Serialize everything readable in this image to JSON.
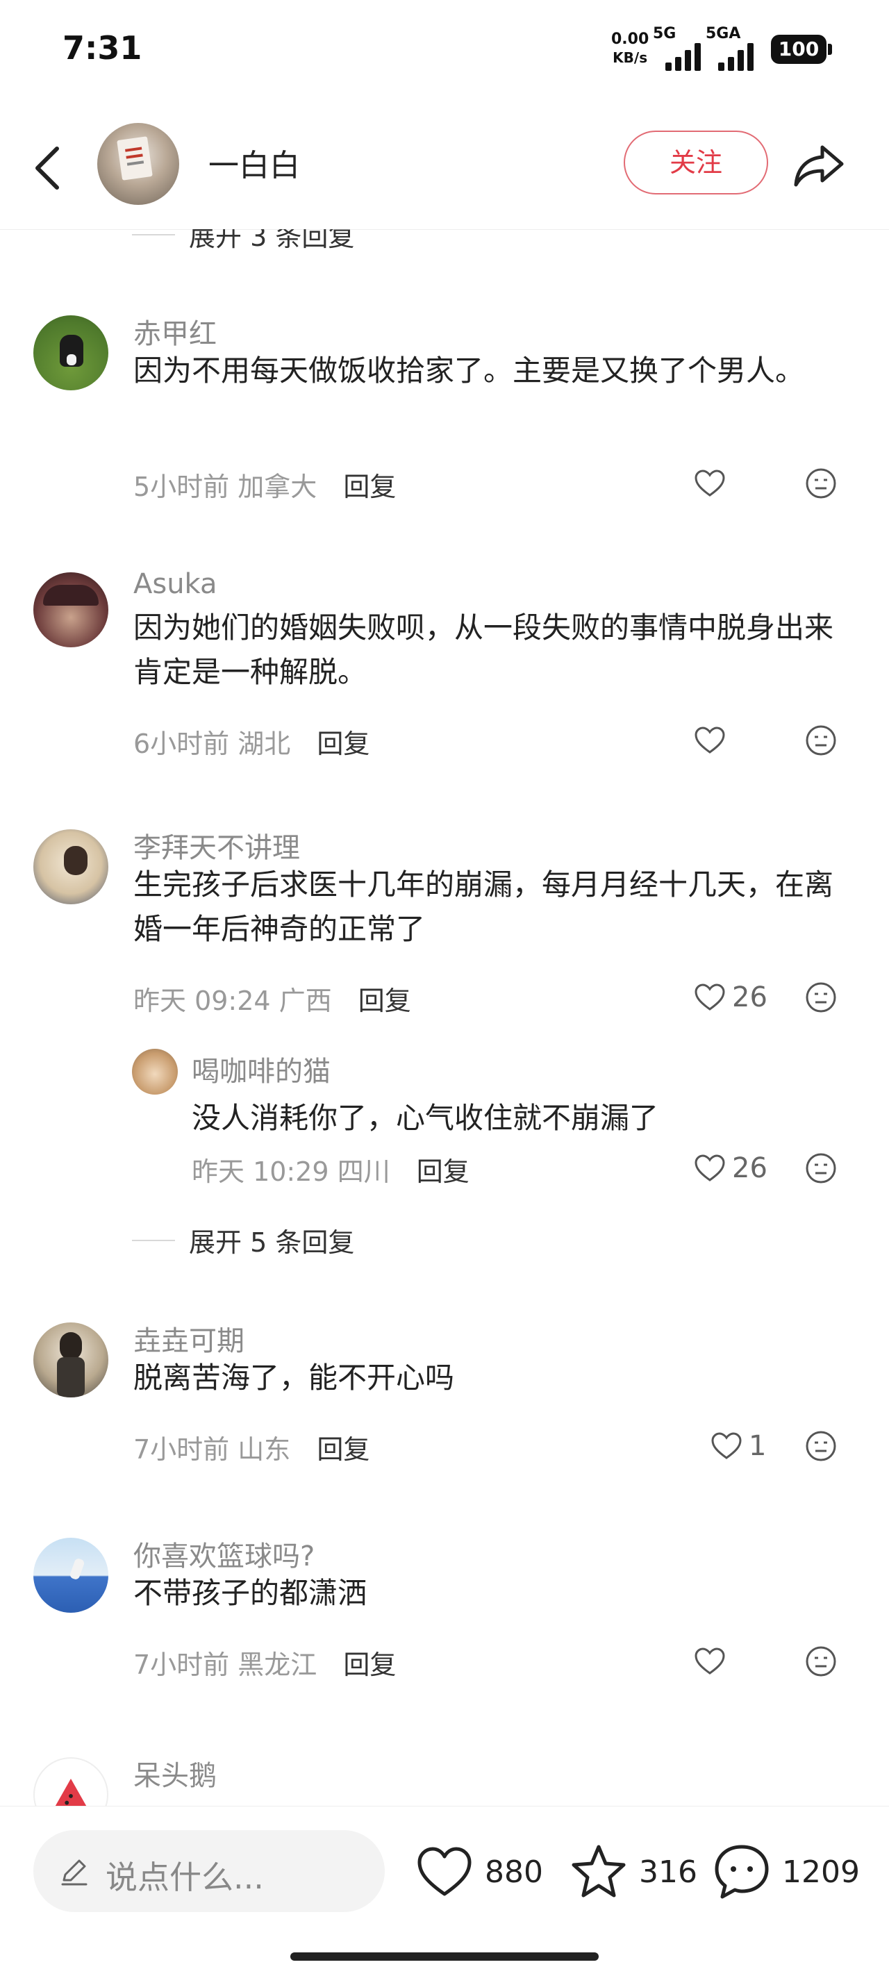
{
  "status_bar": {
    "time": "7:31",
    "net_speed_value": "0.00",
    "net_speed_unit": "KB/s",
    "signal1_label": "5G",
    "signal2_label": "5GA",
    "battery": "100"
  },
  "header": {
    "username": "一白白",
    "follow_label": "关注"
  },
  "colors": {
    "accent": "#e23b47",
    "text_primary": "#222222",
    "text_secondary": "#999999"
  },
  "top_expand": {
    "label": "展开 3 条回复"
  },
  "comments": [
    {
      "user": "赤甲红",
      "text": "因为不用每天做饭收拾家了。主要是又换了个男人。",
      "time": "5小时前",
      "location": "加拿大",
      "reply_label": "回复",
      "likes": ""
    },
    {
      "user": "Asuka",
      "text": "因为她们的婚姻失败呗，从一段失败的事情中脱身出来肯定是一种解脱。",
      "time": "6小时前",
      "location": "湖北",
      "reply_label": "回复",
      "likes": ""
    },
    {
      "user": "李拜天不讲理",
      "text": "生完孩子后求医十几年的崩漏，每月月经十几天，在离婚一年后神奇的正常了",
      "time": "昨天 09:24",
      "location": "广西",
      "reply_label": "回复",
      "likes": "26",
      "reply": {
        "user": "喝咖啡的猫",
        "text": "没人消耗你了，心气收住就不崩漏了",
        "time": "昨天 10:29",
        "location": "四川",
        "reply_label": "回复",
        "likes": "26"
      },
      "expand_label": "展开 5 条回复"
    },
    {
      "user": "垚垚可期",
      "text": "脱离苦海了，能不开心吗",
      "time": "7小时前",
      "location": "山东",
      "reply_label": "回复",
      "likes": "1"
    },
    {
      "user": "你喜欢篮球吗?",
      "text": "不带孩子的都潇洒",
      "time": "7小时前",
      "location": "黑龙江",
      "reply_label": "回复",
      "likes": ""
    },
    {
      "user": "呆头鹅"
    }
  ],
  "bottom_bar": {
    "input_placeholder": "说点什么...",
    "likes": "880",
    "favorites": "316",
    "comments": "1209"
  }
}
